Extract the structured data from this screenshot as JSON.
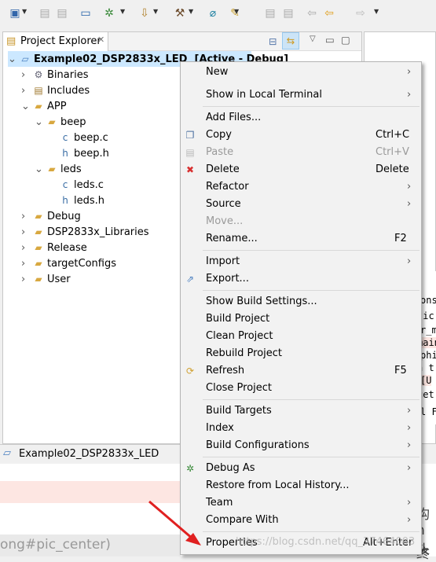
{
  "toolbar": {
    "icons": [
      "new-icon",
      "save-icon",
      "save-all-icon",
      "terminal-icon",
      "debug-icon",
      "import-icon",
      "build-hammer-icon",
      "search-icon",
      "flash-icon",
      "prev-edit-icon",
      "next-annotation-icon",
      "back-history-icon",
      "back-arrow-icon",
      "forward-arrow-icon"
    ]
  },
  "project_explorer": {
    "tab_label": "Project Explorer",
    "tree": [
      {
        "label": "Example02_DSP2833x_LED  [Active - Debug]",
        "depth": 0,
        "expanded": true,
        "icon": "ccs-project-icon",
        "bold": true
      },
      {
        "label": "Binaries",
        "depth": 1,
        "expanded": false,
        "icon": "binaries-icon"
      },
      {
        "label": "Includes",
        "depth": 1,
        "expanded": false,
        "icon": "includes-icon"
      },
      {
        "label": "APP",
        "depth": 1,
        "expanded": true,
        "icon": "folder-icon"
      },
      {
        "label": "beep",
        "depth": 2,
        "expanded": true,
        "icon": "folder-icon"
      },
      {
        "label": "beep.c",
        "depth": 3,
        "expanded": false,
        "icon": "c-file-icon"
      },
      {
        "label": "beep.h",
        "depth": 3,
        "expanded": false,
        "icon": "h-file-icon"
      },
      {
        "label": "leds",
        "depth": 2,
        "expanded": true,
        "icon": "folder-icon"
      },
      {
        "label": "leds.c",
        "depth": 3,
        "expanded": false,
        "icon": "c-file-icon"
      },
      {
        "label": "leds.h",
        "depth": 3,
        "expanded": false,
        "icon": "h-file-icon"
      },
      {
        "label": "Debug",
        "depth": 1,
        "expanded": false,
        "icon": "folder-icon"
      },
      {
        "label": "DSP2833x_Libraries",
        "depth": 1,
        "expanded": false,
        "icon": "folder-icon"
      },
      {
        "label": "Release",
        "depth": 1,
        "expanded": false,
        "icon": "folder-icon"
      },
      {
        "label": "targetConfigs",
        "depth": 1,
        "expanded": false,
        "icon": "folder-icon"
      },
      {
        "label": "User",
        "depth": 1,
        "expanded": false,
        "icon": "folder-icon"
      }
    ]
  },
  "status_bar": {
    "label": "Example02_DSP2833x_LED"
  },
  "console_fragments": [
    "ons",
    "tic",
    "r_m",
    "main",
    "phi",
    "n t",
    "[U",
    "get",
    "l Fi"
  ],
  "web": {
    "url_fragment": "ong#pic_center)",
    "cn_fragments": [
      "构",
      "h头",
      "终"
    ],
    "watermark": "https://blog.csdn.net/qq_37464003"
  },
  "context_menu": {
    "items": [
      {
        "label": "New",
        "submenu": true
      },
      {
        "label": "Show in Local Terminal",
        "submenu": true,
        "sep_after": true
      },
      {
        "label": "Add Files..."
      },
      {
        "label": "Copy",
        "shortcut": "Ctrl+C",
        "icon": "copy-icon"
      },
      {
        "label": "Paste",
        "shortcut": "Ctrl+V",
        "icon": "paste-icon",
        "disabled": true
      },
      {
        "label": "Delete",
        "shortcut": "Delete",
        "icon": "delete-icon"
      },
      {
        "label": "Refactor",
        "submenu": true
      },
      {
        "label": "Source",
        "submenu": true
      },
      {
        "label": "Move...",
        "disabled": true
      },
      {
        "label": "Rename...",
        "shortcut": "F2",
        "sep_after": true
      },
      {
        "label": "Import",
        "submenu": true
      },
      {
        "label": "Export...",
        "icon": "export-icon",
        "sep_after": true
      },
      {
        "label": "Show Build Settings..."
      },
      {
        "label": "Build Project"
      },
      {
        "label": "Clean Project"
      },
      {
        "label": "Rebuild Project"
      },
      {
        "label": "Refresh",
        "shortcut": "F5",
        "icon": "refresh-icon"
      },
      {
        "label": "Close Project",
        "sep_after": true
      },
      {
        "label": "Build Targets",
        "submenu": true
      },
      {
        "label": "Index",
        "submenu": true
      },
      {
        "label": "Build Configurations",
        "submenu": true,
        "sep_after": true
      },
      {
        "label": "Debug As",
        "submenu": true,
        "icon": "debug-icon"
      },
      {
        "label": "Restore from Local History..."
      },
      {
        "label": "Team",
        "submenu": true
      },
      {
        "label": "Compare With",
        "submenu": true,
        "sep_after": true
      },
      {
        "label": "Properties",
        "shortcut": "Alt+Enter"
      }
    ]
  },
  "annotation": {
    "arrow_color": "#e02020",
    "target": "Properties"
  }
}
